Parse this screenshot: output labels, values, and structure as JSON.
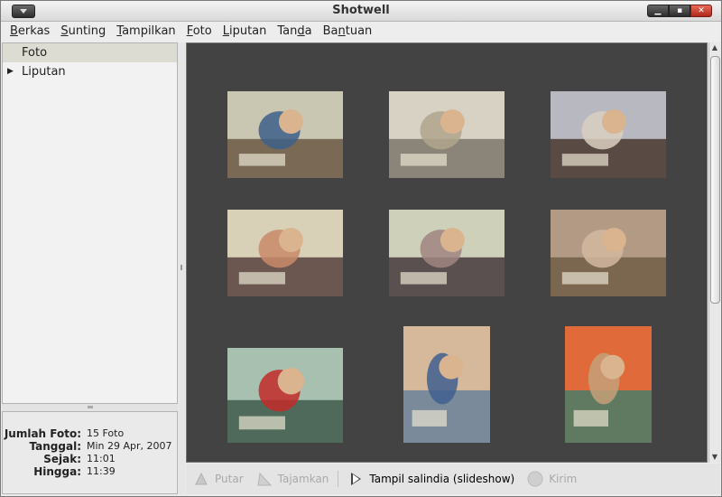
{
  "window": {
    "title": "Shotwell"
  },
  "menubar": [
    {
      "label": "Berkas",
      "mn": "B",
      "rest": "erkas"
    },
    {
      "label": "Sunting",
      "mn": "S",
      "rest": "unting"
    },
    {
      "label": "Tampilkan",
      "mn": "T",
      "rest": "ampilkan"
    },
    {
      "label": "Foto",
      "mn": "F",
      "rest": "oto"
    },
    {
      "label": "Liputan",
      "mn": "L",
      "rest": "iputan"
    },
    {
      "label": "Tanda",
      "pre": "Tan",
      "mn": "d",
      "rest": "a"
    },
    {
      "label": "Bantuan",
      "pre": "Ba",
      "mn": "n",
      "rest": "tuan"
    }
  ],
  "sidebar": {
    "items": [
      {
        "label": "Foto",
        "selected": true
      },
      {
        "label": "Liputan",
        "expander": "▶"
      }
    ]
  },
  "info": {
    "rows": [
      {
        "key": "Jumlah Foto:",
        "value": "15 Foto"
      },
      {
        "key": "Tanggal:",
        "value": "Min 29 Apr, 2007"
      },
      {
        "key": "Sejak:",
        "value": "11:01"
      },
      {
        "key": "Hingga:",
        "value": "11:39"
      }
    ]
  },
  "toolbar": {
    "rotate": "Putar",
    "sharpen": "Tajamkan",
    "slideshow": "Tampil salindia (slideshow)",
    "send": "Kirim"
  },
  "photos": [
    {
      "name": "photo-mother-child-floor",
      "colors": [
        "#7a6a55",
        "#c9c6b2",
        "#3e5f8a"
      ]
    },
    {
      "name": "photo-birthday-banner",
      "colors": [
        "#8b8478",
        "#d8d2c4",
        "#b0a48c"
      ]
    },
    {
      "name": "photo-mother-baby-blue",
      "colors": [
        "#5a4a44",
        "#b7b8c0",
        "#d9cfc0"
      ]
    },
    {
      "name": "photo-baby-cake-1",
      "colors": [
        "#6c5750",
        "#d8d1b7",
        "#c98a6a"
      ]
    },
    {
      "name": "photo-baby-candle",
      "colors": [
        "#5a5050",
        "#cfd0ba",
        "#a08580"
      ]
    },
    {
      "name": "photo-boy-gifts",
      "colors": [
        "#7b6650",
        "#b29a84",
        "#d4b8a0"
      ]
    },
    {
      "name": "photo-baby-walker",
      "colors": [
        "#4f6a5a",
        "#a8c0b0",
        "#c22a2a"
      ]
    },
    {
      "name": "photo-boy-smiling",
      "colors": [
        "#7a8a9a",
        "#d6b89a",
        "#3f5f8f"
      ]
    },
    {
      "name": "photo-boy-cap",
      "colors": [
        "#5f7a60",
        "#e06a3a",
        "#c6a07a"
      ]
    }
  ]
}
